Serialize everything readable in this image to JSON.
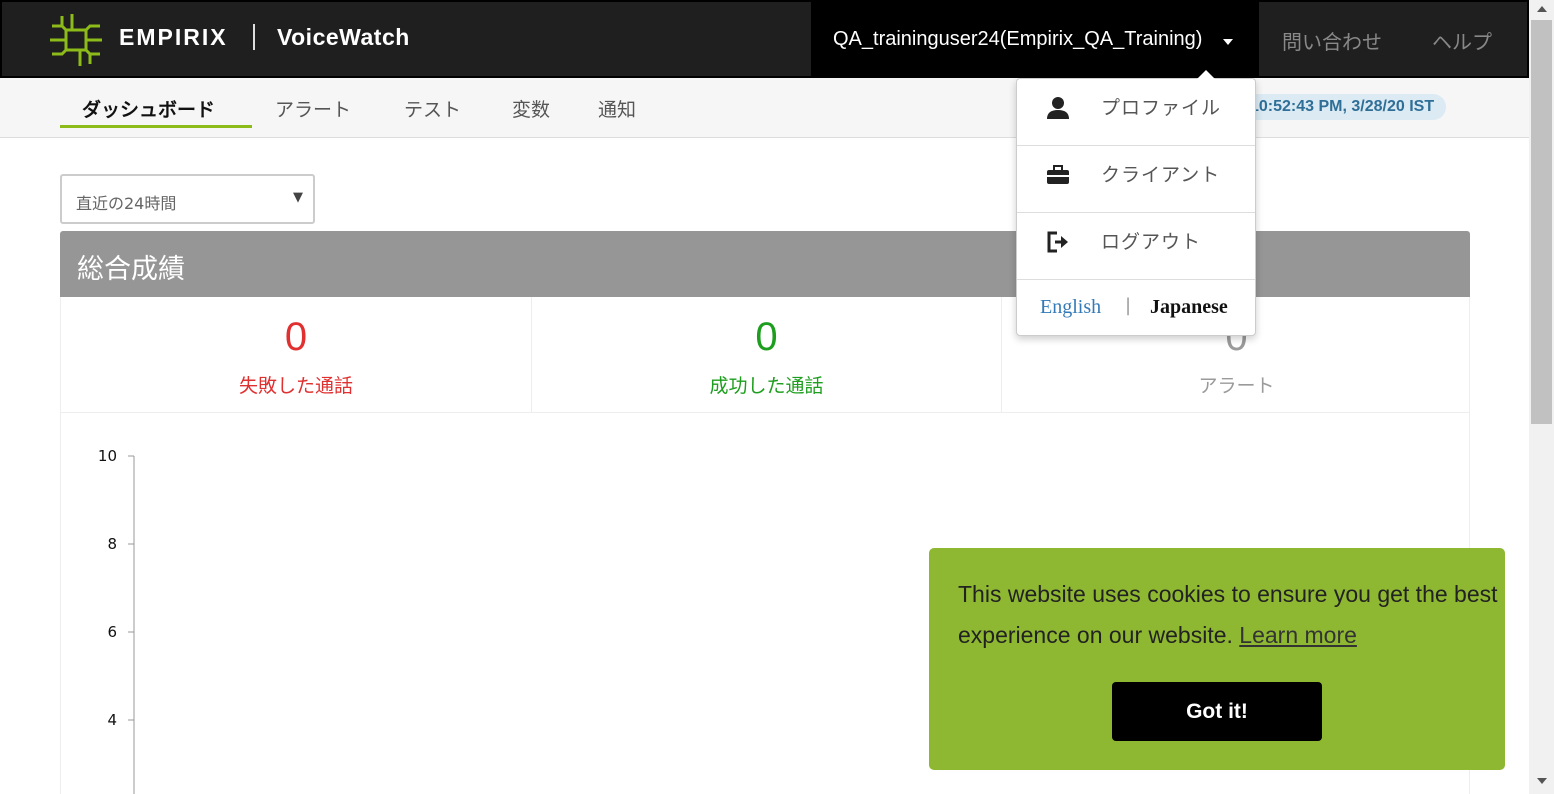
{
  "header": {
    "brand": "EMPIRIX",
    "product": "VoiceWatch",
    "user": "QA_traininguser24(Empirix_QA_Training)",
    "nav_right": [
      "問い合わせ",
      "ヘルプ"
    ],
    "logo_icon": "empirix-logo-icon",
    "brand_color": "#8dbb1a"
  },
  "tabs": {
    "items": [
      {
        "label": "ダッシュボード",
        "active": true
      },
      {
        "label": "アラート"
      },
      {
        "label": "テスト"
      },
      {
        "label": "変数"
      },
      {
        "label": "通知"
      }
    ],
    "timestamp": "10:52:43 PM, 3/28/20 IST"
  },
  "range": {
    "selected": "直近の24時間"
  },
  "panel": {
    "title": "総合成績",
    "stats": [
      {
        "value": "0",
        "label": "失敗した通話",
        "color": "#e03030"
      },
      {
        "value": "0",
        "label": "成功した通話",
        "color": "#1e9e1e"
      },
      {
        "value": "0",
        "label": "アラート",
        "color": "#9a9a9a"
      }
    ]
  },
  "chart_data": {
    "type": "line",
    "yticks": [
      "10",
      "8",
      "6",
      "4"
    ],
    "ylim": [
      4,
      10
    ],
    "series": []
  },
  "dropdown": {
    "items": [
      {
        "label": "プロファイル",
        "icon": "user-icon"
      },
      {
        "label": "クライアント",
        "icon": "briefcase-icon"
      },
      {
        "label": "ログアウト",
        "icon": "logout-icon"
      }
    ],
    "lang_en": "English",
    "lang_sep": "|",
    "lang_ja": "Japanese"
  },
  "cookie": {
    "text": "This website uses cookies to ensure you get the best experience on our website.",
    "link": "Learn more",
    "button": "Got it!",
    "bg_color": "#8fb832"
  }
}
